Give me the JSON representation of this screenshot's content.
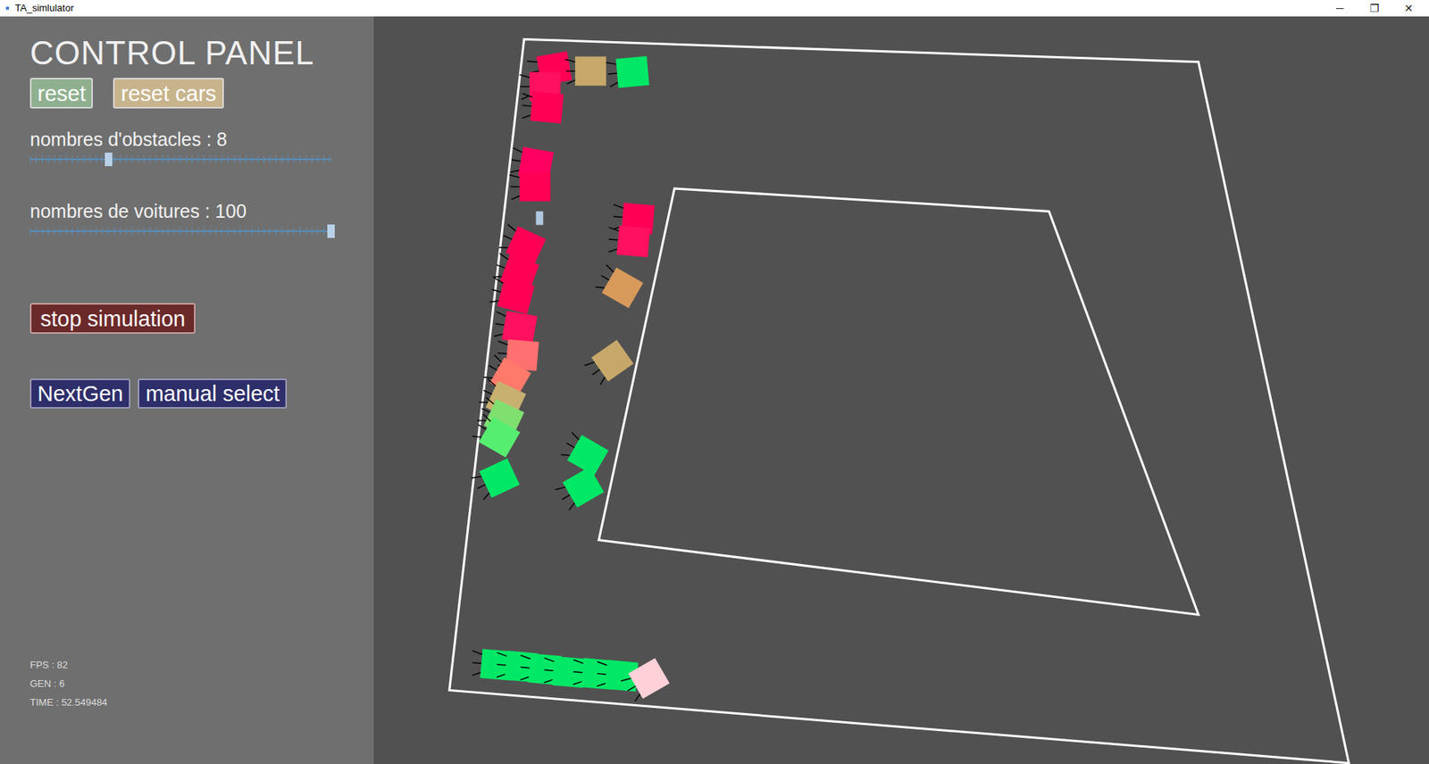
{
  "window": {
    "title": "TA_simlulator",
    "controls": [
      "─",
      "❐",
      "✕"
    ]
  },
  "panel": {
    "title": "CONTROL PANEL",
    "buttons": [
      {
        "label": "reset",
        "color": "#8fb08f"
      },
      {
        "label": "reset cars",
        "color": "#c8b48c"
      }
    ],
    "sliders": [
      {
        "label": "nombres d'obstacles : 8",
        "level": 0.26
      },
      {
        "label": "nombres de voitures : 100",
        "level": 1
      }
    ],
    "simulation_button": "stop simulation",
    "actions": [
      "NextGen",
      "manual select"
    ],
    "stats": [
      "FPS : 82",
      "GEN : 6",
      "TIME : 52.549484"
    ]
  },
  "canvas": {
    "cars": [
      {
        "color": "#ff0055"
      },
      {
        "color": "#ff1060"
      },
      {
        "color": "#ff0055"
      },
      {
        "color": "#c8a86a"
      },
      {
        "color": "#00e865"
      },
      {
        "color": "#ff0060"
      },
      {
        "color": "#ff0055"
      },
      {
        "color": "#ff0055"
      },
      {
        "color": "#ff0055"
      },
      {
        "color": "#ff0055"
      },
      {
        "color": "#ff1060"
      },
      {
        "color": "#ff7070"
      },
      {
        "color": "#ff7a6a"
      },
      {
        "color": "#c8b070"
      },
      {
        "color": "#7fe070"
      },
      {
        "color": "#55ee70"
      },
      {
        "color": "#00e865"
      },
      {
        "color": "#00e865"
      },
      {
        "color": "#00e865"
      },
      {
        "color": "#ff0055"
      },
      {
        "color": "#ff1060"
      },
      {
        "color": "#d89a5a"
      },
      {
        "color": "#c8a86a"
      },
      {
        "color": "#00e865"
      },
      {
        "color": "#00e865"
      },
      {
        "color": "#00e865"
      },
      {
        "color": "#00e865"
      },
      {
        "color": "#00e865"
      },
      {
        "color": "#00e865"
      },
      {
        "color": "#ffd0d8"
      }
    ]
  }
}
